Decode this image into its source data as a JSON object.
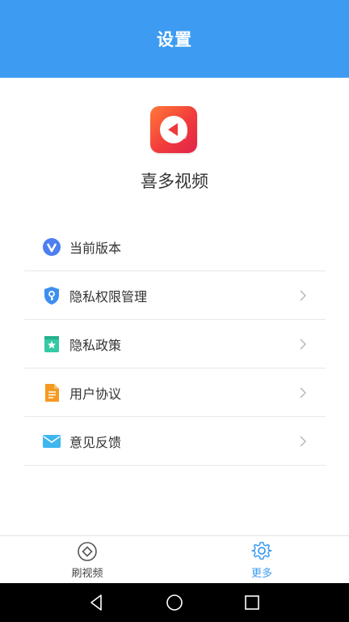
{
  "header": {
    "title": "设置"
  },
  "app": {
    "name": "喜多视频"
  },
  "menu": {
    "items": [
      {
        "label": "当前版本",
        "icon": "version-v-icon"
      },
      {
        "label": "隐私权限管理",
        "icon": "shield-key-icon"
      },
      {
        "label": "隐私政策",
        "icon": "bookmark-star-icon"
      },
      {
        "label": "用户协议",
        "icon": "document-icon"
      },
      {
        "label": "意见反馈",
        "icon": "mail-icon"
      }
    ]
  },
  "tabbar": {
    "tabs": [
      {
        "label": "刷视频",
        "active": false
      },
      {
        "label": "更多",
        "active": true
      }
    ]
  },
  "colors": {
    "accent": "#3d9cf2",
    "logo": "#f23b3b"
  }
}
